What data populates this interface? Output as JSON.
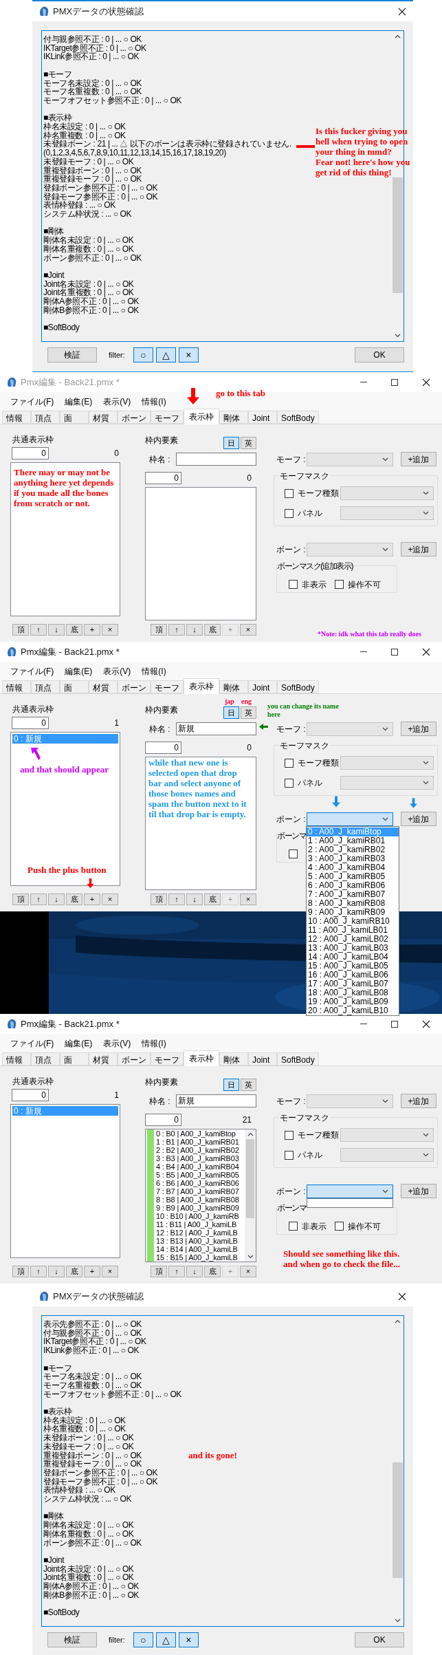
{
  "panels": [
    {
      "kind": "check_dialog",
      "title": "PMXデータの状態確認",
      "sections": [
        {
          "lines": [
            "付与親参照不正 : 0 | ... ○ OK",
            "IKTarget参照不正 : 0 | ... ○ OK",
            "IKLink参照不正 : 0 | ... ○ OK"
          ]
        },
        {
          "heading": "■モーフ",
          "lines": [
            "モーフ名未設定 : 0 | ... ○ OK",
            "モーフ名重複数 : 0 | ... ○ OK",
            "モーフオフセット参照不正 : 0 | ... ○ OK"
          ]
        },
        {
          "heading": "■表示枠",
          "lines": [
            "枠名未設定 : 0 | ... ○ OK",
            "枠名重複数 : 0 | ... ○ OK",
            "未登録ボーン : 21 | ... △ 以下のボーンは表示枠に登録されていません.",
            "(0,1,2,3,4,5,6,7,8,9,10,11,12,13,14,15,16,17,18,19,20)",
            "未登録モーフ : 0 | ... ○ OK",
            "重複登録ボーン : 0 | ... ○ OK",
            "重複登録モーフ : 0 | ... ○ OK",
            "登録ボーン参照不正 : 0 | ... ○ OK",
            "登録モーフ参照不正 : 0 | ... ○ OK",
            "表情枠登録 : ... ○ OK",
            "システム枠状況 : ... ○ OK"
          ]
        },
        {
          "heading": "■剛体",
          "lines": [
            "剛体名未設定 : 0 | ... ○ OK",
            "剛体名重複数 : 0 | ... ○ OK",
            "ボーン参照不正 : 0 | ... ○ OK"
          ]
        },
        {
          "heading": "■Joint",
          "lines": [
            "Joint名未設定 : 0 | ... ○ OK",
            "Joint名重複数 : 0 | ... ○ OK",
            "剛体A参照不正 : 0 | ... ○ OK",
            "剛体B参照不正 : 0 | ... ○ OK"
          ]
        },
        {
          "heading": "■SoftBody"
        }
      ],
      "verify_button": "検証",
      "filter_label": "filter:",
      "filters": [
        {
          "label": "○",
          "selected": true
        },
        {
          "label": "△",
          "selected": true
        },
        {
          "label": "×",
          "selected": true
        }
      ],
      "ok_button": "OK",
      "annotations": [
        {
          "kind": "warning_arrow",
          "text": "Is this fucker giving you hell when trying to open your thing in mmd?\nFear not! here's how you get rid of this thing!",
          "color": "#ff0000"
        }
      ]
    },
    {
      "kind": "dialog_edge"
    },
    {
      "kind": "editor",
      "title": "Pmx編集 - Back21.pmx *",
      "active": false,
      "menu": [
        "ファイル(F)",
        "編集(E)",
        "表示(V)",
        "情報(I)"
      ],
      "tabs": [
        {
          "label": "情報",
          "selected": false
        },
        {
          "label": "頂点",
          "selected": false
        },
        {
          "label": "面",
          "selected": false
        },
        {
          "label": "材質",
          "selected": false
        },
        {
          "label": "ボーン",
          "selected": false
        },
        {
          "label": "モーフ",
          "selected": false
        },
        {
          "label": "表示枠",
          "selected": true
        },
        {
          "label": "剛体",
          "selected": false
        },
        {
          "label": "Joint",
          "selected": false
        },
        {
          "label": "SoftBody",
          "selected": false
        }
      ],
      "frames": {
        "label": "共通表示枠",
        "index_value": "0",
        "count": "0",
        "buttons": [
          {
            "label": "頂",
            "disabled": false
          },
          {
            "label": "↑",
            "disabled": false
          },
          {
            "label": "↓",
            "disabled": false
          },
          {
            "label": "底",
            "disabled": false
          },
          {
            "label": "+",
            "disabled": false
          },
          {
            "label": "×",
            "disabled": false
          }
        ]
      },
      "elements": {
        "label": "枠内要素",
        "lang_buttons": [
          {
            "label": "日",
            "selected": true
          },
          {
            "label": "英",
            "selected": false
          }
        ],
        "name_label": "枠名 :",
        "index_value": "0",
        "count": "0",
        "buttons": [
          {
            "label": "頂",
            "disabled": false
          },
          {
            "label": "↑",
            "disabled": false
          },
          {
            "label": "↓",
            "disabled": false
          },
          {
            "label": "底",
            "disabled": false
          },
          {
            "label": "+",
            "disabled": true
          },
          {
            "label": "×",
            "disabled": false
          }
        ]
      },
      "morph": {
        "label": "モーフ :",
        "add_button": "+追加"
      },
      "morph_mask": {
        "title": "モーフマスク",
        "checks": [
          {
            "label": "モーフ種類",
            "checked": false
          },
          {
            "label": "パネル",
            "checked": false
          }
        ]
      },
      "bone": {
        "label": "ボーン :",
        "add_button": "+追加",
        "focused": false,
        "dropdown_open": false
      },
      "bone_mask": {
        "title": "ボーンマスク(追加表示)",
        "checks": [
          {
            "label": "非表示",
            "checked": false
          },
          {
            "label": "操作不可",
            "checked": false
          }
        ]
      },
      "annotations": [
        {
          "kind": "tab_hint",
          "text": "go to this tab",
          "color": "#ff0000"
        },
        {
          "kind": "list_note",
          "text": "There may or may not be anything here yet depends if you made all the bones from scratch or not.",
          "color": "#ff0000"
        },
        {
          "kind": "footnote",
          "text": "*Note: idk what this tab really does",
          "color": "#cc00ff"
        }
      ]
    },
    {
      "kind": "editor",
      "title": "Pmx編集 - Back21.pmx *",
      "active": true,
      "menu": [
        "ファイル(F)",
        "編集(E)",
        "表示(V)",
        "情報(I)"
      ],
      "tabs": [
        {
          "label": "情報",
          "selected": false
        },
        {
          "label": "頂点",
          "selected": false
        },
        {
          "label": "面",
          "selected": false
        },
        {
          "label": "材質",
          "selected": false
        },
        {
          "label": "ボーン",
          "selected": false
        },
        {
          "label": "モーフ",
          "selected": false
        },
        {
          "label": "表示枠",
          "selected": true
        },
        {
          "label": "剛体",
          "selected": false
        },
        {
          "label": "Joint",
          "selected": false
        },
        {
          "label": "SoftBody",
          "selected": false
        }
      ],
      "frames": {
        "label": "共通表示枠",
        "index_value": "0",
        "count": "1",
        "items": [
          {
            "text": "0 : 新規",
            "selected": true
          }
        ],
        "buttons": [
          {
            "label": "頂",
            "disabled": false
          },
          {
            "label": "↑",
            "disabled": false
          },
          {
            "label": "↓",
            "disabled": false
          },
          {
            "label": "底",
            "disabled": false
          },
          {
            "label": "+",
            "disabled": false
          },
          {
            "label": "×",
            "disabled": false
          }
        ]
      },
      "elements": {
        "label": "枠内要素",
        "lang_buttons": [
          {
            "label": "日",
            "selected": true
          },
          {
            "label": "英",
            "selected": false
          }
        ],
        "name_label": "枠名 :",
        "name_value": "新規",
        "index_value": "0",
        "count": "0",
        "buttons": [
          {
            "label": "頂",
            "disabled": false
          },
          {
            "label": "↑",
            "disabled": false
          },
          {
            "label": "↓",
            "disabled": false
          },
          {
            "label": "底",
            "disabled": false
          },
          {
            "label": "+",
            "disabled": true
          },
          {
            "label": "×",
            "disabled": false
          }
        ]
      },
      "morph": {
        "label": "モーフ :",
        "add_button": "+追加"
      },
      "morph_mask": {
        "title": "モーフマスク",
        "checks": [
          {
            "label": "モーフ種類",
            "checked": false
          },
          {
            "label": "パネル",
            "checked": false
          }
        ]
      },
      "bone": {
        "label": "ボーン :",
        "add_button": "+追加",
        "focused": true,
        "dropdown_open": true,
        "dropdown_items": [
          {
            "text": "0 : A00_J_kamiBtop",
            "selected": true
          },
          {
            "text": "1 : A00_J_kamiRB01",
            "selected": false
          },
          {
            "text": "2 : A00_J_kamiRB02",
            "selected": false
          },
          {
            "text": "3 : A00_J_kamiRB03",
            "selected": false
          },
          {
            "text": "4 : A00_J_kamiRB04",
            "selected": false
          },
          {
            "text": "5 : A00_J_kamiRB05",
            "selected": false
          },
          {
            "text": "6 : A00_J_kamiRB06",
            "selected": false
          },
          {
            "text": "7 : A00_J_kamiRB07",
            "selected": false
          },
          {
            "text": "8 : A00_J_kamiRB08",
            "selected": false
          },
          {
            "text": "9 : A00_J_kamiRB09",
            "selected": false
          },
          {
            "text": "10 : A00_J_kamiRB10",
            "selected": false
          },
          {
            "text": "11 : A00_J_kamiLB01",
            "selected": false
          },
          {
            "text": "12 : A00_J_kamiLB02",
            "selected": false
          },
          {
            "text": "13 : A00_J_kamiLB03",
            "selected": false
          },
          {
            "text": "14 : A00_J_kamiLB04",
            "selected": false
          },
          {
            "text": "15 : A00_J_kamiLB05",
            "selected": false
          },
          {
            "text": "16 : A00_J_kamiLB06",
            "selected": false
          },
          {
            "text": "17 : A00_J_kamiLB07",
            "selected": false
          },
          {
            "text": "18 : A00_J_kamiLB08",
            "selected": false
          },
          {
            "text": "19 : A00_J_kamiLB09",
            "selected": false
          },
          {
            "text": "20 : A00_J_kamiLB10",
            "selected": false
          }
        ]
      },
      "bone_mask": {
        "title": "ボーンマ",
        "checks": [
          {
            "checked": false
          }
        ]
      },
      "annotations": [
        {
          "kind": "jap_label",
          "text": "jap",
          "color": "#ff0040"
        },
        {
          "kind": "eng_label",
          "text": "eng",
          "color": "#ff0040"
        },
        {
          "kind": "name_hint",
          "text": "you can change its name here",
          "color": "#008000"
        },
        {
          "kind": "appear_note",
          "text": "and that should appear",
          "color": "#cc00ff"
        },
        {
          "kind": "plus_hint",
          "text": "Push the plus button",
          "color": "#ff0000"
        },
        {
          "kind": "elements_note",
          "text": "while that new one is selected open that drop bar and select anyone of those bones names and spam the button next to it til that drop bar is empty.",
          "color": "#1e9be6"
        },
        {
          "kind": "bone_arrows",
          "color": "#1e8fe6"
        }
      ]
    },
    {
      "kind": "desktop"
    },
    {
      "kind": "editor",
      "title": "Pmx編集 - Back21.pmx *",
      "active": true,
      "menu": [
        "ファイル(F)",
        "編集(E)",
        "表示(V)",
        "情報(I)"
      ],
      "tabs": [
        {
          "label": "情報",
          "selected": false
        },
        {
          "label": "頂点",
          "selected": false
        },
        {
          "label": "面",
          "selected": false
        },
        {
          "label": "材質",
          "selected": false
        },
        {
          "label": "ボーン",
          "selected": false
        },
        {
          "label": "モーフ",
          "selected": false
        },
        {
          "label": "表示枠",
          "selected": true
        },
        {
          "label": "剛体",
          "selected": false
        },
        {
          "label": "Joint",
          "selected": false
        },
        {
          "label": "SoftBody",
          "selected": false
        }
      ],
      "frames": {
        "label": "共通表示枠",
        "index_value": "0",
        "count": "1",
        "items": [
          {
            "text": "0 : 新規",
            "selected": true
          }
        ],
        "buttons": [
          {
            "label": "頂",
            "disabled": false
          },
          {
            "label": "↑",
            "disabled": false
          },
          {
            "label": "↓",
            "disabled": false
          },
          {
            "label": "底",
            "disabled": false
          },
          {
            "label": "+",
            "disabled": false
          },
          {
            "label": "×",
            "disabled": false
          }
        ]
      },
      "elements": {
        "label": "枠内要素",
        "lang_buttons": [
          {
            "label": "日",
            "selected": true
          },
          {
            "label": "英",
            "selected": false
          }
        ],
        "name_label": "枠名 :",
        "name_value": "新規",
        "index_value": "0",
        "count": "21",
        "items": [
          "0 : B0 | A00_J_kamiBtop",
          "1 : B1 | A00_J_kamiRB01",
          "2 : B2 | A00_J_kamiRB02",
          "3 : B3 | A00_J_kamiRB03",
          "4 : B4 | A00_J_kamiRB04",
          "5 : B5 | A00_J_kamiRB05",
          "6 : B6 | A00_J_kamiRB06",
          "7 : B7 | A00_J_kamiRB07",
          "8 : B8 | A00_J_kamiRB08",
          "9 : B9 | A00_J_kamiRB09",
          "10 : B10 | A00_J_kamiRB",
          "11 : B11 | A00_J_kamiLB",
          "12 : B12 | A00_J_kamiLB",
          "13 : B13 | A00_J_kamiLB",
          "14 : B14 | A00_J_kamiLB",
          "15 : B15 | A00_J_kamiLB"
        ],
        "buttons": [
          {
            "label": "頂",
            "disabled": false
          },
          {
            "label": "↑",
            "disabled": false
          },
          {
            "label": "↓",
            "disabled": false
          },
          {
            "label": "底",
            "disabled": false
          },
          {
            "label": "+",
            "disabled": true
          },
          {
            "label": "×",
            "disabled": false
          }
        ]
      },
      "morph": {
        "label": "モーフ :",
        "add_button": "+追加"
      },
      "morph_mask": {
        "title": "モーフマスク",
        "checks": [
          {
            "label": "モーフ種類",
            "checked": false
          },
          {
            "label": "パネル",
            "checked": false
          }
        ]
      },
      "bone": {
        "label": "ボーン :",
        "add_button": "+追加",
        "focused": true,
        "dropdown_open": true
      },
      "bone_mask": {
        "title": "ボーンマ",
        "checks": [
          {
            "label": "非表示",
            "checked": false
          },
          {
            "label": "操作不可",
            "checked": false
          }
        ]
      },
      "annotations": [
        {
          "kind": "result_note",
          "text": "Should see something like this.\nand when go to check the file...",
          "color": "#ff0000"
        }
      ]
    },
    {
      "kind": "check_dialog",
      "title": "PMXデータの状態確認",
      "sections": [
        {
          "lines": [
            "表示先参照不正 : 0 | ... ○ OK",
            "付与親参照不正 : 0 | ... ○ OK",
            "IKTarget参照不正 : 0 | ... ○ OK",
            "IKLink参照不正 : 0 | ... ○ OK"
          ]
        },
        {
          "heading": "■モーフ",
          "lines": [
            "モーフ名未設定 : 0 | ... ○ OK",
            "モーフ名重複数 : 0 | ... ○ OK",
            "モーフオフセット参照不正 : 0 | ... ○ OK"
          ]
        },
        {
          "heading": "■表示枠",
          "lines": [
            "枠名未設定 : 0 | ... ○ OK",
            "枠名重複数 : 0 | ... ○ OK",
            "未登録ボーン : 0 | ... ○ OK",
            "未登録モーフ : 0 | ... ○ OK",
            "重複登録ボーン : 0 | ... ○ OK",
            "重複登録モーフ : 0 | ... ○ OK",
            "登録ボーン参照不正 : 0 | ... ○ OK",
            "登録モーフ参照不正 : 0 | ... ○ OK",
            "表情枠登録 : ... ○ OK",
            "システム枠状況 : ... ○ OK"
          ]
        },
        {
          "heading": "■剛体",
          "lines": [
            "剛体名未設定 : 0 | ... ○ OK",
            "剛体名重複数 : 0 | ... ○ OK",
            "ボーン参照不正 : 0 | ... ○ OK"
          ]
        },
        {
          "heading": "■Joint",
          "lines": [
            "Joint名未設定 : 0 | ... ○ OK",
            "Joint名重複数 : 0 | ... ○ OK",
            "剛体A参照不正 : 0 | ... ○ OK",
            "剛体B参照不正 : 0 | ... ○ OK"
          ]
        },
        {
          "heading": "■SoftBody"
        }
      ],
      "verify_button": "検証",
      "filter_label": "filter:",
      "filters": [
        {
          "label": "○",
          "selected": true
        },
        {
          "label": "△",
          "selected": true
        },
        {
          "label": "×",
          "selected": true
        }
      ],
      "ok_button": "OK",
      "annotations": [
        {
          "kind": "gone_note",
          "text": "and its gone!",
          "color": "#ff0000"
        }
      ]
    }
  ]
}
